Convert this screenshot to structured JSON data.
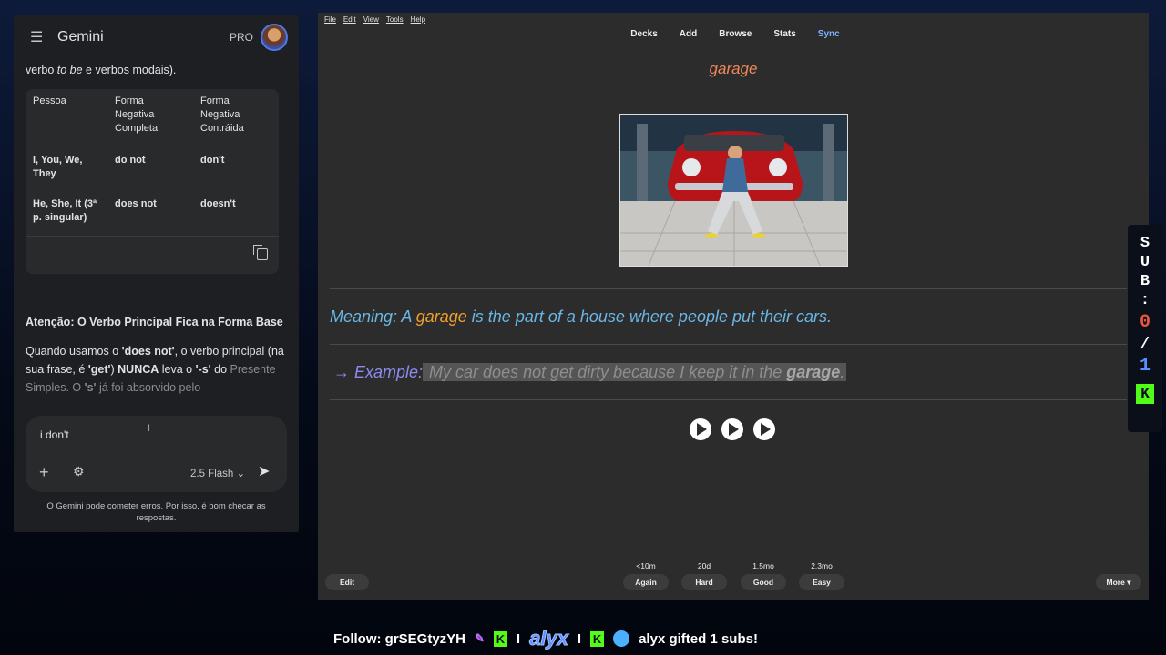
{
  "gemini": {
    "title": "Gemini",
    "badge": "PRO",
    "intro_prefix": "verbo ",
    "intro_italic": "to be",
    "intro_suffix": " e verbos modais).",
    "table": {
      "headers": [
        "Pessoa",
        "Forma Negativa Completa",
        "Forma Negativa Contráida"
      ],
      "rows": [
        [
          "I, You, We, They",
          "do not",
          "don't"
        ],
        [
          "He, She, It (3ª p. singular)",
          "does not",
          "doesn't"
        ]
      ]
    },
    "heading": "Atenção: O Verbo Principal Fica na Forma Base",
    "para": {
      "p1": "Quando usamos o ",
      "b1": "'does not'",
      "p2": ", o verbo principal (na sua frase, é ",
      "b2": "'get'",
      "p3": ") ",
      "b3": "NUNCA",
      "p4": " leva o ",
      "b4": "'-s'",
      "p5": " do ",
      "fade1": "Presente Simples. O ",
      "b5": "'s'",
      "fade2": " já foi absorvido pelo"
    },
    "input_value": "i don't",
    "model": "2.5 Flash",
    "disclaimer": "O Gemini pode cometer erros. Por isso, é bom checar as respostas."
  },
  "anki": {
    "menu": [
      "File",
      "Edit",
      "View",
      "Tools",
      "Help"
    ],
    "nav": [
      "Decks",
      "Add",
      "Browse",
      "Stats",
      "Sync"
    ],
    "word": "garage",
    "meaning": {
      "prefix": "Meaning: A ",
      "keyword": "garage",
      "suffix": " is the part of a house where people put their cars."
    },
    "example": {
      "label": "→ Example:",
      "text_prefix": " My car does not get dirty because I keep it in the ",
      "text_bold": "garage",
      "text_suffix": "."
    },
    "bottom": {
      "edit": "Edit",
      "more": "More ▾",
      "answers": [
        {
          "time": "<10m",
          "label": "Again"
        },
        {
          "time": "20d",
          "label": "Hard"
        },
        {
          "time": "1.5mo",
          "label": "Good"
        },
        {
          "time": "2.3mo",
          "label": "Easy"
        }
      ]
    }
  },
  "sub_counter": {
    "letters": [
      "S",
      "U",
      "B",
      ":"
    ],
    "current": "0",
    "slash": "/",
    "goal": "1",
    "kick": "K"
  },
  "ticker": {
    "follow": "Follow: grSEGtyzYH",
    "sep": "I",
    "logo": "alyx",
    "gift": "alyx gifted 1 subs!"
  }
}
